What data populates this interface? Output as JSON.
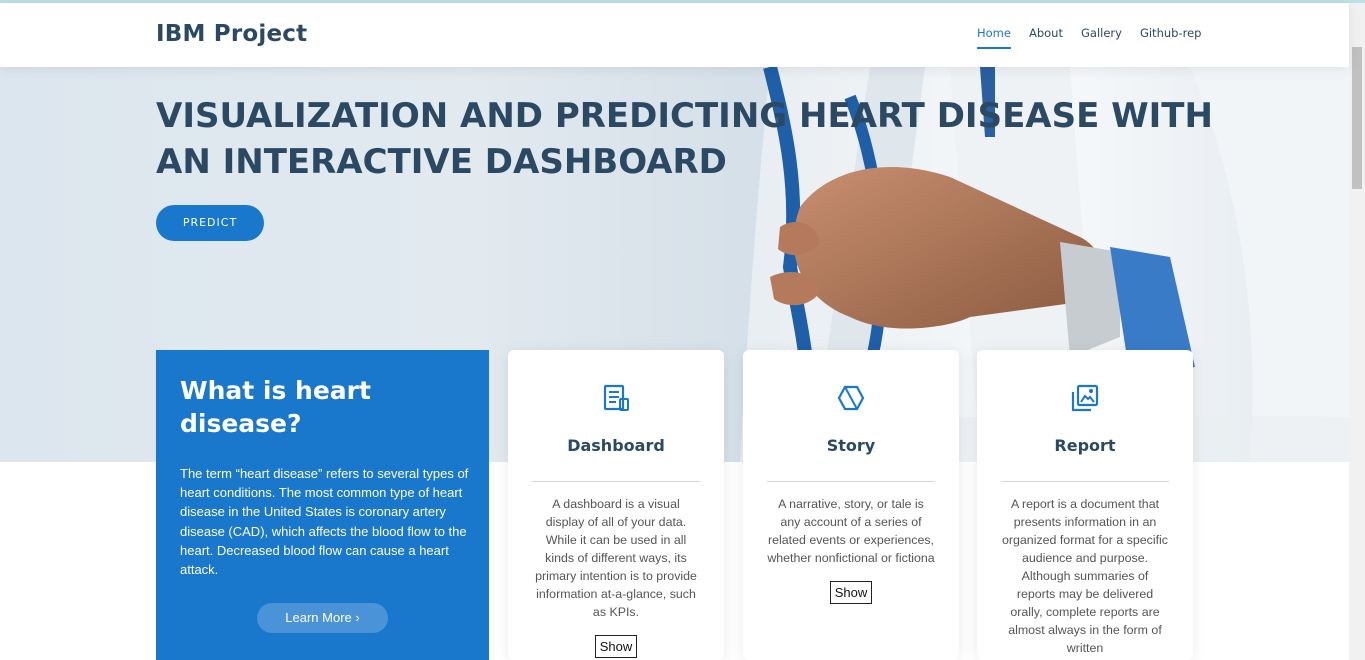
{
  "header": {
    "logo": "IBM Project",
    "nav": [
      {
        "label": "Home"
      },
      {
        "label": "About"
      },
      {
        "label": "Gallery"
      },
      {
        "label": "Github-rep"
      }
    ]
  },
  "hero": {
    "title": "VISUALIZATION AND PREDICTING HEART DISEASE WITH AN INTERACTIVE DASHBOARD",
    "button": "PREDICT"
  },
  "why": {
    "title": "What is heart disease?",
    "text": "The term “heart disease” refers to several types of heart conditions. The most common type of heart disease in the United States is coronary artery disease (CAD), which affects the blood flow to the heart. Decreased blood flow can cause a heart attack.",
    "button": "Learn More ›"
  },
  "cards": [
    {
      "icon": "document-icon",
      "title": "Dashboard",
      "text": "A dashboard is a visual display of all of your data. While it can be used in all kinds of different ways, its primary intention is to provide information at-a-glance, such as KPIs.",
      "button": "Show"
    },
    {
      "icon": "cube-icon",
      "title": "Story",
      "text": "A narrative, story, or tale is any account of a series of related events or experiences, whether nonfictional or fictiona",
      "button": "Show"
    },
    {
      "icon": "images-icon",
      "title": "Report",
      "text": "A report is a document that presents information in an organized format for a specific audience and purpose. Although summaries of reports may be delivered orally, complete reports are almost always in the form of written",
      "button": ""
    }
  ],
  "colors": {
    "accent": "#1977cc",
    "heading": "#2c4964"
  }
}
